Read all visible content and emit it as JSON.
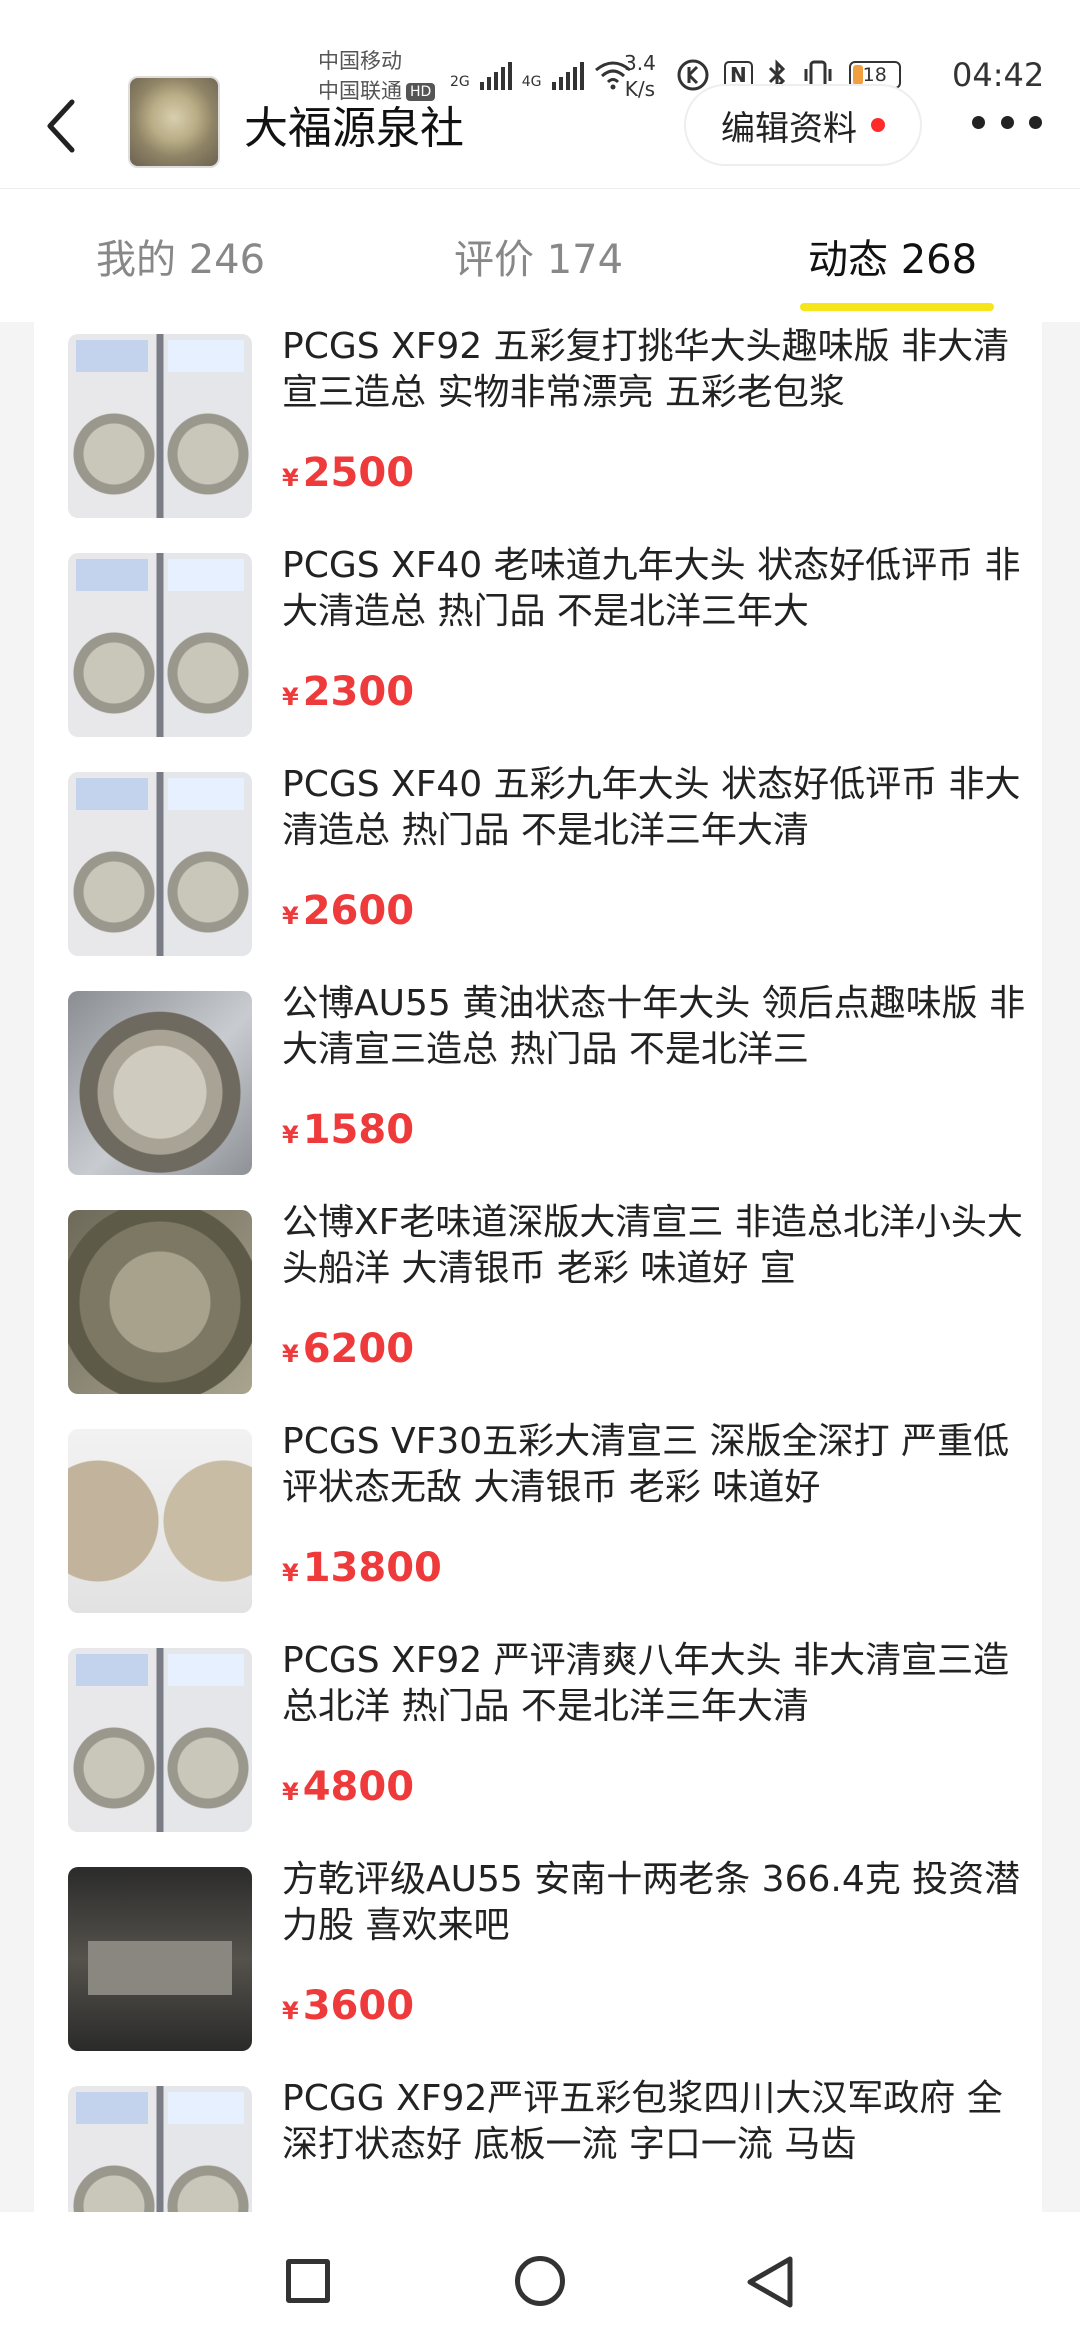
{
  "status_bar": {
    "carrier_1": "中国移动",
    "carrier_2": "中国联通",
    "hd_badge": "HD",
    "net_1": "2G",
    "net_2": "4G",
    "speed_value": "3.4",
    "speed_unit": "K/s",
    "nfc": "N",
    "battery": "18",
    "time": "04:42"
  },
  "header": {
    "shop_name": "大福源泉社",
    "edit_button": "编辑资料",
    "back_icon": "chevron-left-icon",
    "more_icon": "more-horizontal-icon"
  },
  "tabs": [
    {
      "label": "我的 246"
    },
    {
      "label": "评价 174"
    },
    {
      "label": "动态 268"
    }
  ],
  "items": [
    {
      "title": "PCGS XF92 五彩复打挑华大头趣味版 非大清宣三造总 实物非常漂亮 五彩老包浆",
      "currency": "¥",
      "price": "2500"
    },
    {
      "title": "PCGS XF40 老味道九年大头 状态好低评币 非大清造总 热门品 不是北洋三年大",
      "currency": "¥",
      "price": "2300"
    },
    {
      "title": "PCGS XF40 五彩九年大头 状态好低评币 非大清造总 热门品 不是北洋三年大清",
      "currency": "¥",
      "price": "2600"
    },
    {
      "title": "公博AU55 黄油状态十年大头 领后点趣味版 非大清宣三造总 热门品 不是北洋三",
      "currency": "¥",
      "price": "1580"
    },
    {
      "title": "公博XF老味道深版大清宣三 非造总北洋小头大头船洋 大清银币 老彩 味道好 宣",
      "currency": "¥",
      "price": "6200"
    },
    {
      "title": "PCGS VF30五彩大清宣三 深版全深打 严重低评状态无敌 大清银币 老彩 味道好",
      "currency": "¥",
      "price": "13800"
    },
    {
      "title": "PCGS XF92 严评清爽八年大头 非大清宣三造总北洋 热门品 不是北洋三年大清",
      "currency": "¥",
      "price": "4800"
    },
    {
      "title": "方乾评级AU55 安南十两老条 366.4克 投资潜力股 喜欢来吧",
      "currency": "¥",
      "price": "3600"
    },
    {
      "title": "PCGG XF92严评五彩包浆四川大汉军政府 全深打状态好 底板一流 字口一流 马齿",
      "currency": "¥",
      "price": ""
    }
  ],
  "colors": {
    "price": "#ee3a3a",
    "tab_indicator": "#f5e51a",
    "notification_dot": "#ff2a2a"
  },
  "nav": {
    "recent_icon": "square-icon",
    "home_icon": "circle-icon",
    "back_icon": "triangle-back-icon"
  }
}
